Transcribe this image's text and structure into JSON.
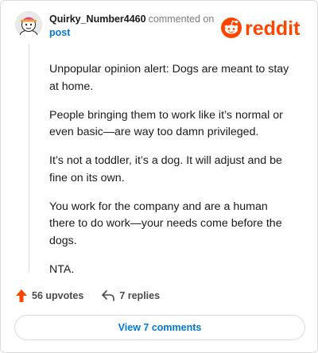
{
  "comment": {
    "username": "Quirky_Number4460",
    "action_text": "commented on",
    "post_link": "post",
    "brand": "reddit",
    "brand_color": "#FF4500",
    "paragraphs": [
      "Unpopular opinion alert: Dogs are meant to stay at home.",
      "People bringing them to work like it’s normal or even basic—are way too damn privileged.",
      "It’s not a toddler, it’s a dog. It will adjust and be fine on its own.",
      "You work for the company and are a human there to do work—your needs come before the dogs.",
      "NTA."
    ]
  },
  "actions": {
    "upvotes": "56 upvotes",
    "replies": "7 replies",
    "upvote_icon": "arrow-up-icon",
    "reply_icon": "reply-arrow-icon"
  },
  "view_button": "View 7 comments"
}
